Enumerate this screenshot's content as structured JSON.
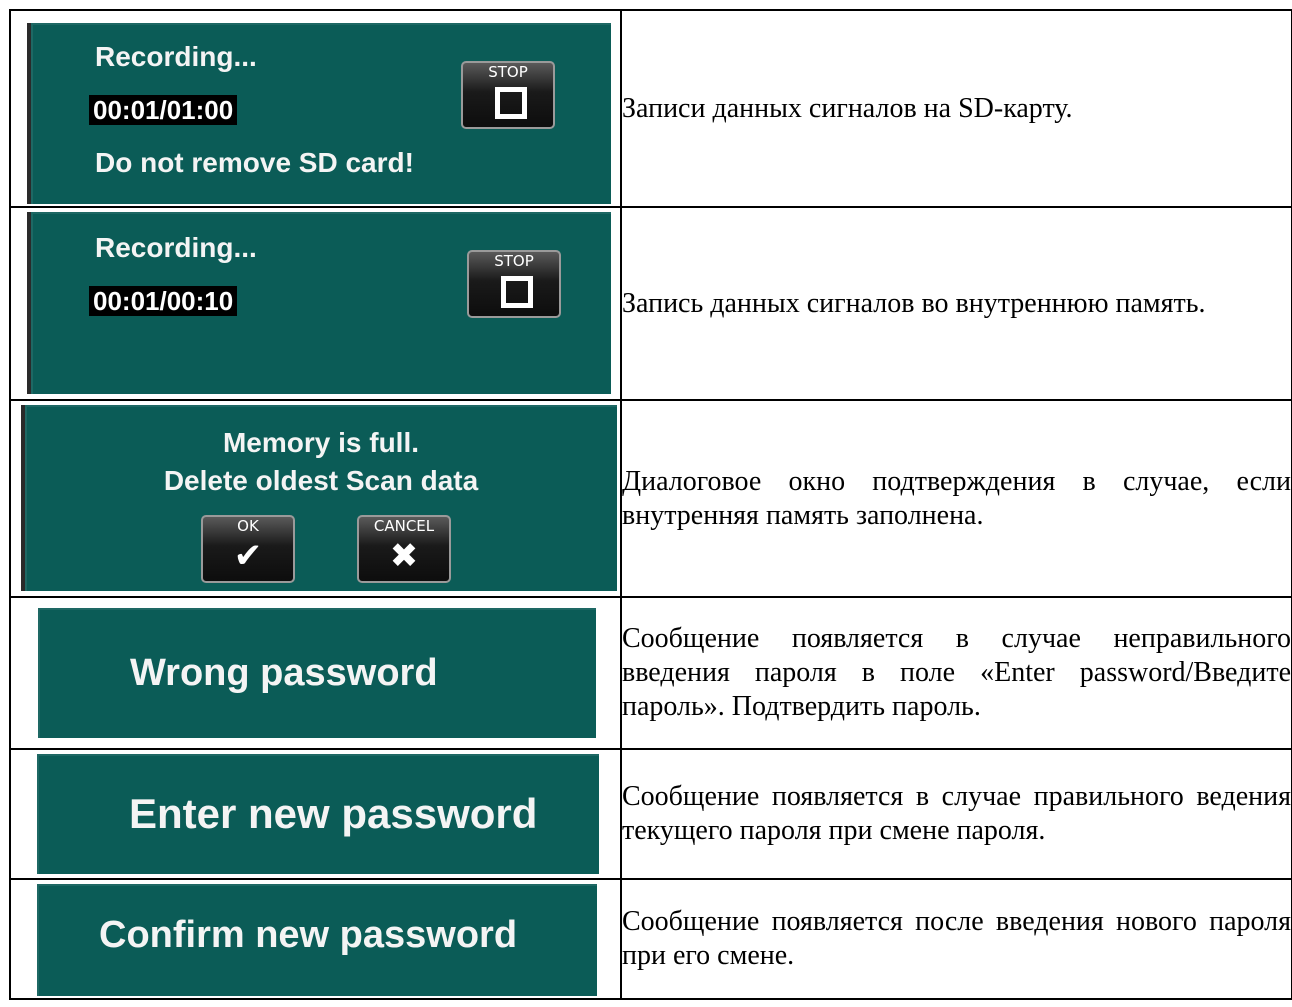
{
  "rows": [
    {
      "screen": {
        "title": "Recording...",
        "timer": "00:01/01:00",
        "warning": "Do not remove SD card!",
        "stop_label": "STOP",
        "stop_icon": "stop-square-icon"
      },
      "description": "Записи данных сигналов на SD-карту."
    },
    {
      "screen": {
        "title": "Recording...",
        "timer": "00:01/00:10",
        "stop_label": "STOP",
        "stop_icon": "stop-square-icon"
      },
      "description": "Запись данных сигналов во внутреннюю память."
    },
    {
      "screen": {
        "line1": "Memory is full.",
        "line2": "Delete oldest Scan data",
        "ok_label": "OK",
        "ok_icon": "✔",
        "cancel_label": "CANCEL",
        "cancel_icon": "✖"
      },
      "description": "Диалоговое окно подтверждения в случае, если внутренняя память заполнена."
    },
    {
      "screen": {
        "message": "Wrong password"
      },
      "description": "Сообщение появляется в случае неправильного введения пароля в поле «Enter password/Введите пароль». Подтвердить пароль."
    },
    {
      "screen": {
        "message": "Enter new password"
      },
      "description": "Сообщение появляется в случае правильного ведения текущего пароля при смене пароля."
    },
    {
      "screen": {
        "message": "Confirm new password"
      },
      "description": "Сообщение появляется после введения нового пароля при его смене."
    }
  ],
  "colors": {
    "panel": "#0b5c57",
    "panel_text": "#f4f4f4",
    "border": "#000000"
  }
}
